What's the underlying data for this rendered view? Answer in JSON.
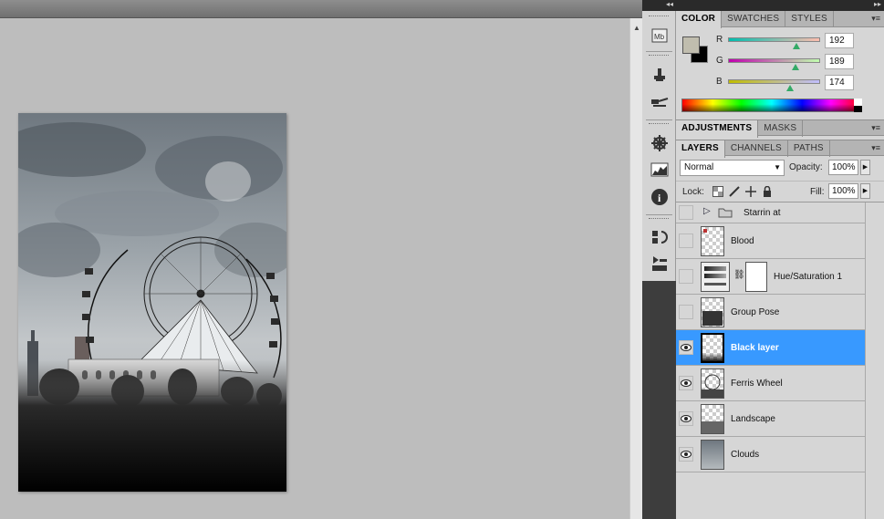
{
  "canvas": {
    "document_image": "amusement-park-composite"
  },
  "color_panel": {
    "tabs": [
      "COLOR",
      "SWATCHES",
      "STYLES"
    ],
    "active_tab": "COLOR",
    "channels": [
      {
        "label": "R",
        "value": "192"
      },
      {
        "label": "G",
        "value": "189"
      },
      {
        "label": "B",
        "value": "174"
      }
    ],
    "foreground": "#c0bdae",
    "background": "#000000"
  },
  "adjustments_panel": {
    "tabs": [
      "ADJUSTMENTS",
      "MASKS"
    ],
    "active_tab": "ADJUSTMENTS"
  },
  "layers_panel": {
    "tabs": [
      "LAYERS",
      "CHANNELS",
      "PATHS"
    ],
    "active_tab": "LAYERS",
    "blend_mode": "Normal",
    "opacity_label": "Opacity:",
    "opacity": "100%",
    "lock_label": "Lock:",
    "fill_label": "Fill:",
    "fill": "100%",
    "layers": [
      {
        "name": "Starrin at",
        "type": "group",
        "visible": false,
        "selected": false
      },
      {
        "name": "Blood",
        "type": "pixel",
        "visible": false,
        "selected": false
      },
      {
        "name": "Hue/Saturation 1",
        "type": "adjustment",
        "visible": false,
        "selected": false
      },
      {
        "name": "Group Pose",
        "type": "pixel",
        "visible": false,
        "selected": false
      },
      {
        "name": "Black layer",
        "type": "pixel",
        "visible": true,
        "selected": true
      },
      {
        "name": "Ferris Wheel",
        "type": "pixel",
        "visible": true,
        "selected": false
      },
      {
        "name": "Landscape",
        "type": "pixel",
        "visible": true,
        "selected": false
      },
      {
        "name": "Clouds",
        "type": "pixel",
        "visible": true,
        "selected": false
      }
    ]
  },
  "dock_icons": [
    "mini-bridge-icon",
    "clone-source-icon",
    "brushes-icon",
    "navigator-icon",
    "histogram-icon",
    "info-icon",
    "history-icon",
    "actions-icon"
  ]
}
